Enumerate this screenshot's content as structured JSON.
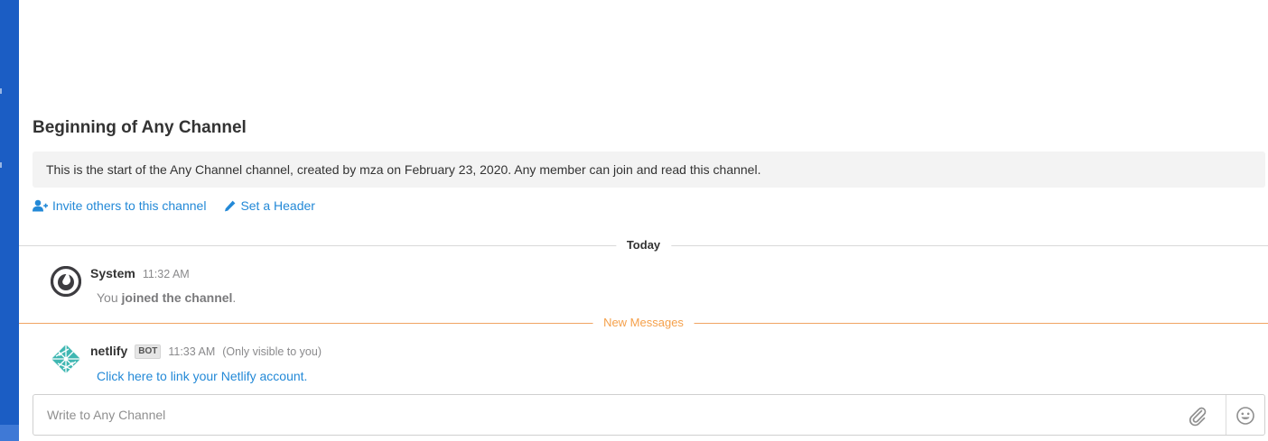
{
  "channel": {
    "intro_title": "Beginning of Any Channel",
    "intro_text": "This is the start of the Any Channel channel, created by mza on February 23, 2020. Any member can join and read this channel.",
    "invite_label": "Invite others to this channel",
    "set_header_label": "Set a Header",
    "invite_icon": "user-plus-icon",
    "set_header_icon": "pencil-icon"
  },
  "separators": {
    "today": "Today",
    "new_messages": "New Messages"
  },
  "posts": [
    {
      "author": "System",
      "time": "11:32 AM",
      "message_prefix": "You ",
      "message_bold": "joined the channel",
      "message_suffix": ".",
      "avatar_icon": "mattermost-logo-icon"
    },
    {
      "author": "netlify",
      "badge": "BOT",
      "time": "11:33 AM",
      "visibility": "(Only visible to you)",
      "message_link": "Click here to link your Netlify account.",
      "avatar_icon": "netlify-logo-icon"
    }
  ],
  "composer": {
    "placeholder": "Write to Any Channel",
    "attach_icon": "paperclip-icon",
    "emoji_icon": "smiley-icon"
  },
  "colors": {
    "sidebar": "#1b5dc4",
    "link": "#2389d7",
    "new_messages": "#f5a04a",
    "separator": "#d8d8d8"
  }
}
